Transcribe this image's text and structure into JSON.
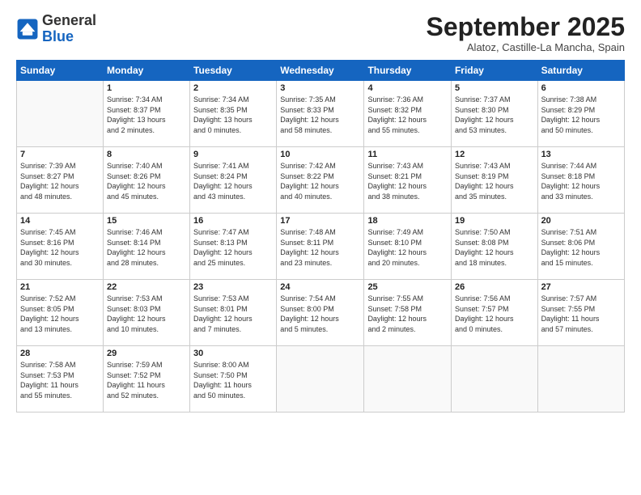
{
  "logo": {
    "general": "General",
    "blue": "Blue"
  },
  "title": "September 2025",
  "location": "Alatoz, Castille-La Mancha, Spain",
  "days_of_week": [
    "Sunday",
    "Monday",
    "Tuesday",
    "Wednesday",
    "Thursday",
    "Friday",
    "Saturday"
  ],
  "weeks": [
    [
      {
        "day": "",
        "info": ""
      },
      {
        "day": "1",
        "info": "Sunrise: 7:34 AM\nSunset: 8:37 PM\nDaylight: 13 hours\nand 2 minutes."
      },
      {
        "day": "2",
        "info": "Sunrise: 7:34 AM\nSunset: 8:35 PM\nDaylight: 13 hours\nand 0 minutes."
      },
      {
        "day": "3",
        "info": "Sunrise: 7:35 AM\nSunset: 8:33 PM\nDaylight: 12 hours\nand 58 minutes."
      },
      {
        "day": "4",
        "info": "Sunrise: 7:36 AM\nSunset: 8:32 PM\nDaylight: 12 hours\nand 55 minutes."
      },
      {
        "day": "5",
        "info": "Sunrise: 7:37 AM\nSunset: 8:30 PM\nDaylight: 12 hours\nand 53 minutes."
      },
      {
        "day": "6",
        "info": "Sunrise: 7:38 AM\nSunset: 8:29 PM\nDaylight: 12 hours\nand 50 minutes."
      }
    ],
    [
      {
        "day": "7",
        "info": "Sunrise: 7:39 AM\nSunset: 8:27 PM\nDaylight: 12 hours\nand 48 minutes."
      },
      {
        "day": "8",
        "info": "Sunrise: 7:40 AM\nSunset: 8:26 PM\nDaylight: 12 hours\nand 45 minutes."
      },
      {
        "day": "9",
        "info": "Sunrise: 7:41 AM\nSunset: 8:24 PM\nDaylight: 12 hours\nand 43 minutes."
      },
      {
        "day": "10",
        "info": "Sunrise: 7:42 AM\nSunset: 8:22 PM\nDaylight: 12 hours\nand 40 minutes."
      },
      {
        "day": "11",
        "info": "Sunrise: 7:43 AM\nSunset: 8:21 PM\nDaylight: 12 hours\nand 38 minutes."
      },
      {
        "day": "12",
        "info": "Sunrise: 7:43 AM\nSunset: 8:19 PM\nDaylight: 12 hours\nand 35 minutes."
      },
      {
        "day": "13",
        "info": "Sunrise: 7:44 AM\nSunset: 8:18 PM\nDaylight: 12 hours\nand 33 minutes."
      }
    ],
    [
      {
        "day": "14",
        "info": "Sunrise: 7:45 AM\nSunset: 8:16 PM\nDaylight: 12 hours\nand 30 minutes."
      },
      {
        "day": "15",
        "info": "Sunrise: 7:46 AM\nSunset: 8:14 PM\nDaylight: 12 hours\nand 28 minutes."
      },
      {
        "day": "16",
        "info": "Sunrise: 7:47 AM\nSunset: 8:13 PM\nDaylight: 12 hours\nand 25 minutes."
      },
      {
        "day": "17",
        "info": "Sunrise: 7:48 AM\nSunset: 8:11 PM\nDaylight: 12 hours\nand 23 minutes."
      },
      {
        "day": "18",
        "info": "Sunrise: 7:49 AM\nSunset: 8:10 PM\nDaylight: 12 hours\nand 20 minutes."
      },
      {
        "day": "19",
        "info": "Sunrise: 7:50 AM\nSunset: 8:08 PM\nDaylight: 12 hours\nand 18 minutes."
      },
      {
        "day": "20",
        "info": "Sunrise: 7:51 AM\nSunset: 8:06 PM\nDaylight: 12 hours\nand 15 minutes."
      }
    ],
    [
      {
        "day": "21",
        "info": "Sunrise: 7:52 AM\nSunset: 8:05 PM\nDaylight: 12 hours\nand 13 minutes."
      },
      {
        "day": "22",
        "info": "Sunrise: 7:53 AM\nSunset: 8:03 PM\nDaylight: 12 hours\nand 10 minutes."
      },
      {
        "day": "23",
        "info": "Sunrise: 7:53 AM\nSunset: 8:01 PM\nDaylight: 12 hours\nand 7 minutes."
      },
      {
        "day": "24",
        "info": "Sunrise: 7:54 AM\nSunset: 8:00 PM\nDaylight: 12 hours\nand 5 minutes."
      },
      {
        "day": "25",
        "info": "Sunrise: 7:55 AM\nSunset: 7:58 PM\nDaylight: 12 hours\nand 2 minutes."
      },
      {
        "day": "26",
        "info": "Sunrise: 7:56 AM\nSunset: 7:57 PM\nDaylight: 12 hours\nand 0 minutes."
      },
      {
        "day": "27",
        "info": "Sunrise: 7:57 AM\nSunset: 7:55 PM\nDaylight: 11 hours\nand 57 minutes."
      }
    ],
    [
      {
        "day": "28",
        "info": "Sunrise: 7:58 AM\nSunset: 7:53 PM\nDaylight: 11 hours\nand 55 minutes."
      },
      {
        "day": "29",
        "info": "Sunrise: 7:59 AM\nSunset: 7:52 PM\nDaylight: 11 hours\nand 52 minutes."
      },
      {
        "day": "30",
        "info": "Sunrise: 8:00 AM\nSunset: 7:50 PM\nDaylight: 11 hours\nand 50 minutes."
      },
      {
        "day": "",
        "info": ""
      },
      {
        "day": "",
        "info": ""
      },
      {
        "day": "",
        "info": ""
      },
      {
        "day": "",
        "info": ""
      }
    ]
  ]
}
